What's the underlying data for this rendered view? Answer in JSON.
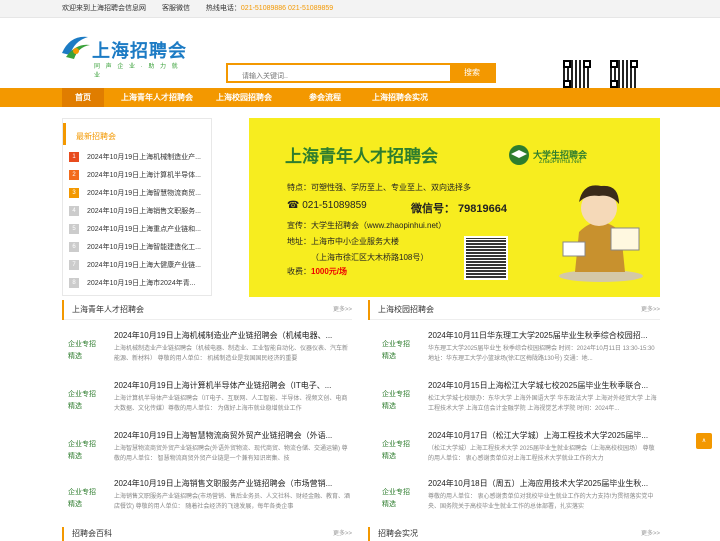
{
  "topbar": {
    "welcome": "欢迎来到上海招聘会信息网",
    "service": "客服微信",
    "hotline_label": "热线电话：",
    "hotline": "021-51089886 021-51089859"
  },
  "logo": {
    "name": "上海招聘会",
    "slogan": "同 声 企 业 · 助 力 就 业"
  },
  "search": {
    "placeholder": "请输入关键词..",
    "button": "搜索"
  },
  "nav": [
    "首页",
    "上海青年人才招聘会",
    "上海校园招聘会",
    "参会流程",
    "上海招聘会实况"
  ],
  "news": {
    "title": "最新招聘会",
    "items": [
      "2024年10月19日上海机械制造业产...",
      "2024年10月19日上海计算机半导体...",
      "2024年10月19日上海智慧物流商贸...",
      "2024年10月19日上海销售文职服务...",
      "2024年10月19日上海重点产业链和...",
      "2024年10月19日上海智能建造化工...",
      "2024年10月19日上海大健康产业链...",
      "2024年10月19日上海市2024年青..."
    ]
  },
  "banner": {
    "title": "上海青年人才招聘会",
    "feature": "特点：可塑性强、学历至上、专业至上、双向选择多",
    "phone": "021-51089859",
    "wechat": "微信号： 79819664",
    "site": "宣传：大学生招聘会（www.zhaopinhui.net）",
    "addr": "地址：上海市中小企业服务大楼",
    "addr2": "（上海市徐汇区大木桥路108号）",
    "fee_label": "收费：",
    "fee": "1000元/场",
    "logo_title": "大学生招聘会",
    "logo_site": "ZhaoPinHui.Net"
  },
  "left_section": {
    "title": "上海青年人才招聘会",
    "more": "更多>>",
    "items": [
      {
        "title": "2024年10月19日上海机械制造业产业链招聘会（机械电器、...",
        "desc": "上海机械制造业产业链招聘会（机械电器、制造业、工业智能自动化、仪器仪表、汽车新能源、新材料）    尊敬的用人单位：    机械制造业是我国国民经济的重要"
      },
      {
        "title": "2024年10月19日上海计算机半导体产业链招聘会（IT电子、...",
        "desc": "上海计算机半导体产业链招聘会（IT电子、互联网、人工智能、半导体、视频文创、电商大数据、文化传媒）尊敬的用人单位：    为做好上海市就业稳增就业工作"
      },
      {
        "title": "2024年10月19日上海智慧物流商贸外贸产业链招聘会（外语...",
        "desc": "上海智慧物流商贸外贸产业链招聘会(外语外贸物流、现代商贸、物流仓储、交通运输)    尊敬的用人单位：    智慧物流商贸外贸产业链是一个兼有知识密集、技"
      },
      {
        "title": "2024年10月19日上海销售文职服务产业链招聘会（市场营销...",
        "desc": "上海销售文职服务产业链招聘会(市场营销、售后业务员、人文社科、财经金融、教育、酒店餐饮)    尊敬的用人单位：    随着社会经济的飞速发展，每年各类企事"
      }
    ]
  },
  "right_section": {
    "title": "上海校园招聘会",
    "more": "更多>>",
    "items": [
      {
        "title": "2024年10月11日华东理工大学2025届毕业生秋季综合校园招...",
        "desc": "华东理工大学2025届毕业生 秋季综合校园招聘会    时间：2024年10月11日 13:30-15:30    地址：华东理工大学小篮球场(徐汇区梅陇路130号)    交通：地..."
      },
      {
        "title": "2024年10月15日上海松江大学城七校2025届毕业生秋季联合...",
        "desc": "松江大学城七校联办：东华大学 上海外国语大学 华东政法大学 上海对外经贸大学 上海工程技术大学 上海立信会计金融学院 上海视觉艺术学院 时间：2024年..."
      },
      {
        "title": "2024年10月17日（松江大学城）上海工程技术大学2025届毕...",
        "desc": "（松江大学城）上海工程技术大学 2025届毕业生就业招聘会（上海高校校园场）    尊敬的用人单位：    衷心感谢贵单位对上海工程技术大学就业工作的大力"
      },
      {
        "title": "2024年10月18日（周五）上海应用技术大学2025届毕业生秋...",
        "desc": "尊敬的用人单位：    衷心感谢贵单位对我校毕业生就业工作的大力支持!为贯彻落实党中央、国务院关于高校毕业生就业工作的总体部署，扎实落实"
      }
    ]
  },
  "thumb": {
    "line1": "企业专招",
    "line2": "精选"
  },
  "bottom": {
    "left": "招聘会百科",
    "right": "招聘会实况",
    "left_more": "更多>>",
    "right_more": "更多>>"
  },
  "side": {
    "up": "∧"
  }
}
